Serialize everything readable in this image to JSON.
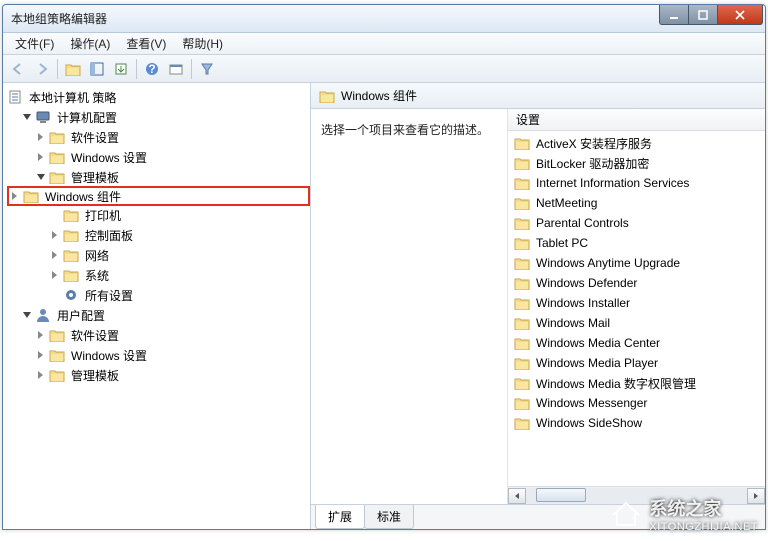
{
  "window": {
    "title": "本地组策略编辑器"
  },
  "menu": {
    "file": "文件(F)",
    "action": "操作(A)",
    "view": "查看(V)",
    "help": "帮助(H)"
  },
  "tree": {
    "root": "本地计算机 策略",
    "computer": "计算机配置",
    "cc_soft": "软件设置",
    "cc_win": "Windows 设置",
    "cc_admin": "管理模板",
    "cc_admin_wincomp": "Windows 组件",
    "cc_admin_printers": "打印机",
    "cc_admin_cp": "控制面板",
    "cc_admin_net": "网络",
    "cc_admin_sys": "系统",
    "cc_admin_all": "所有设置",
    "user": "用户配置",
    "uc_soft": "软件设置",
    "uc_win": "Windows 设置",
    "uc_admin": "管理模板"
  },
  "path": {
    "label": "Windows 组件"
  },
  "detail": {
    "description": "选择一个项目来查看它的描述。",
    "settings_header": "设置",
    "items": [
      "ActiveX 安装程序服务",
      "BitLocker 驱动器加密",
      "Internet Information Services",
      "NetMeeting",
      "Parental Controls",
      "Tablet PC",
      "Windows Anytime Upgrade",
      "Windows Defender",
      "Windows Installer",
      "Windows Mail",
      "Windows Media Center",
      "Windows Media Player",
      "Windows Media 数字权限管理",
      "Windows Messenger",
      "Windows SideShow"
    ]
  },
  "tabs": {
    "extended": "扩展",
    "standard": "标准"
  },
  "watermark": {
    "brand": "系统之家",
    "url": "XITONGZHIJIA.NET"
  }
}
